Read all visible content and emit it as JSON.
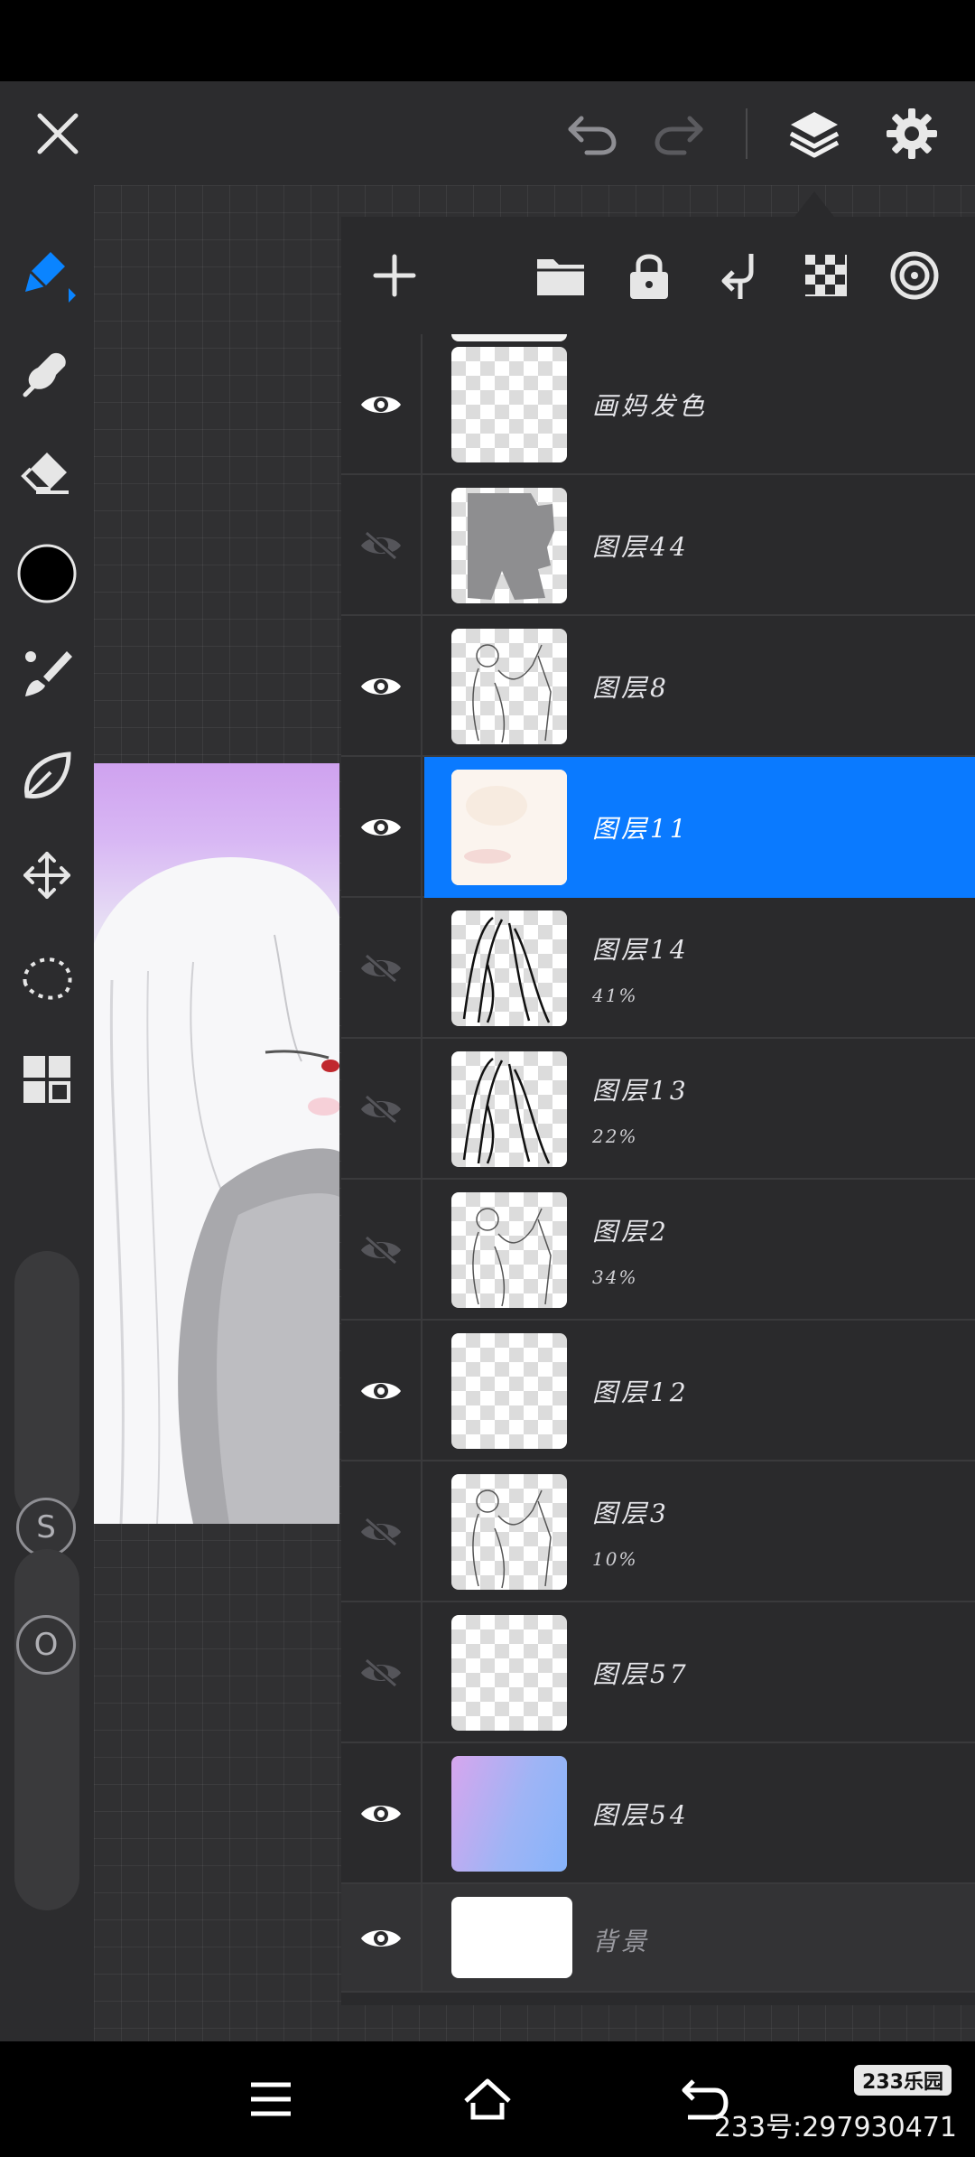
{
  "toolbar": {
    "close_icon": "close-icon",
    "undo_icon": "undo-icon",
    "redo_icon": "redo-icon",
    "layers_icon": "layers-icon",
    "settings_icon": "gear-icon"
  },
  "left_tools": [
    {
      "name": "pencil-tool",
      "icon": "pencil-icon",
      "active": true
    },
    {
      "name": "smudge-tool",
      "icon": "smudge-icon"
    },
    {
      "name": "eraser-tool",
      "icon": "eraser-icon"
    },
    {
      "name": "color-swatch",
      "icon": "color-circle",
      "color": "#000000"
    },
    {
      "name": "brush-tool",
      "icon": "brush-icon"
    },
    {
      "name": "leaf-tool",
      "icon": "leaf-icon"
    },
    {
      "name": "transform-tool",
      "icon": "move-arrows-icon"
    },
    {
      "name": "lasso-tool",
      "icon": "lasso-icon"
    },
    {
      "name": "gallery-tool",
      "icon": "grid-icon"
    }
  ],
  "sliders": {
    "size_label": "S",
    "opacity_label": "O"
  },
  "layer_panel": {
    "tools": [
      "add-layer-icon",
      "folder-icon",
      "lock-icon",
      "merge-down-icon",
      "checker-icon",
      "target-icon"
    ],
    "layers": [
      {
        "name": "画妈发色",
        "visible": true,
        "opacity": "",
        "selected": false,
        "thumb": "checker"
      },
      {
        "name": "图层44",
        "visible": false,
        "opacity": "",
        "selected": false,
        "thumb": "gray-shape"
      },
      {
        "name": "图层8",
        "visible": true,
        "opacity": "",
        "selected": false,
        "thumb": "sketch"
      },
      {
        "name": "图层11",
        "visible": true,
        "opacity": "",
        "selected": true,
        "thumb": "pale"
      },
      {
        "name": "图层14",
        "visible": false,
        "opacity": "41%",
        "selected": false,
        "thumb": "hair-lines"
      },
      {
        "name": "图层13",
        "visible": false,
        "opacity": "22%",
        "selected": false,
        "thumb": "hair-lines"
      },
      {
        "name": "图层2",
        "visible": false,
        "opacity": "34%",
        "selected": false,
        "thumb": "sketch"
      },
      {
        "name": "图层12",
        "visible": true,
        "opacity": "",
        "selected": false,
        "thumb": "checker"
      },
      {
        "name": "图层3",
        "visible": false,
        "opacity": "10%",
        "selected": false,
        "thumb": "sketch"
      },
      {
        "name": "图层57",
        "visible": false,
        "opacity": "",
        "selected": false,
        "thumb": "checker"
      },
      {
        "name": "图层54",
        "visible": true,
        "opacity": "",
        "selected": false,
        "thumb": "gradient"
      },
      {
        "name": "背景",
        "visible": true,
        "opacity": "",
        "selected": false,
        "thumb": "white"
      }
    ]
  },
  "nav": {
    "menu_icon": "menu-icon",
    "home_icon": "home-icon",
    "back_icon": "back-icon"
  },
  "watermark": {
    "logo": "233乐园",
    "text": "233号:297930471"
  },
  "colors": {
    "accent": "#0a7aff",
    "panel_bg": "#2a2a2c",
    "app_bg": "#2c2c2e"
  }
}
